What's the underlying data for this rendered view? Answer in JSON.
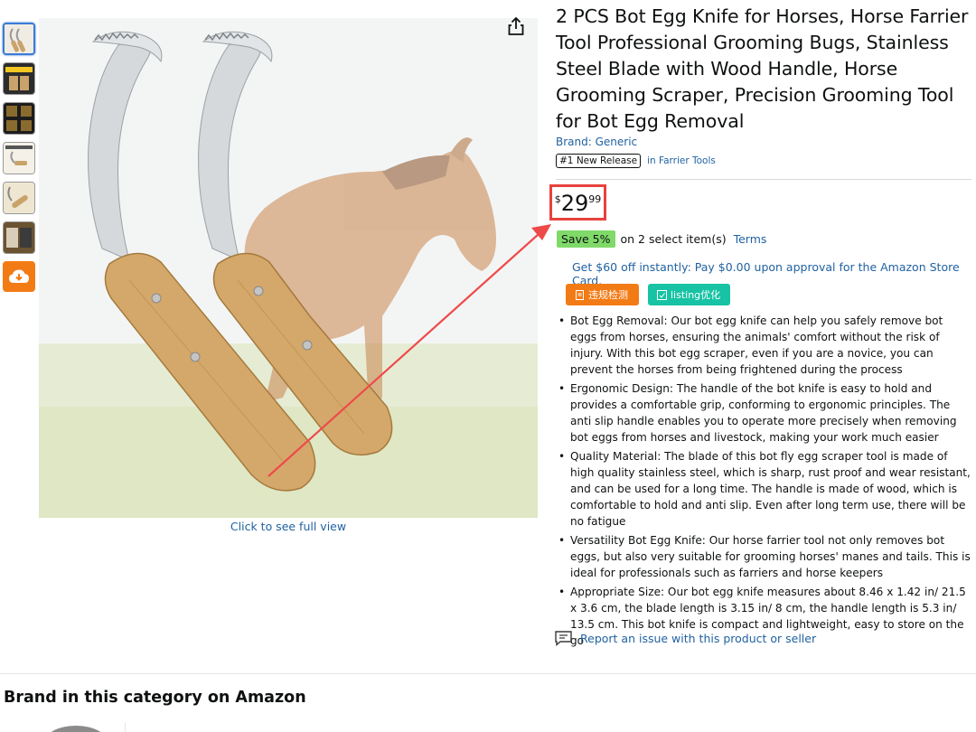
{
  "product": {
    "title": "2 PCS Bot Egg Knife for Horses, Horse Farrier Tool Professional Grooming Bugs, Stainless Steel Blade with Wood Handle, Horse Grooming Scraper, Precision Grooming Tool for Bot Egg Removal",
    "brand_link": "Brand: Generic",
    "rank_badge": "#1 New Release",
    "rank_category": "in Farrier Tools"
  },
  "gallery": {
    "thumbnail_count": 6,
    "full_view_link": "Click to see full view"
  },
  "price": {
    "currency": "$",
    "whole": "29",
    "fraction": "99"
  },
  "savings": {
    "badge": "Save 5%",
    "text": "on 2 select item(s)",
    "terms_link": "Terms"
  },
  "card_offer": "Get $60 off instantly: Pay $0.00 upon approval for the Amazon Store Card.",
  "plugin_buttons": {
    "violation_check": "违规检测",
    "listing_optimize": "listing优化"
  },
  "bullets": [
    "Bot Egg Removal: Our bot egg knife can help you safely remove bot eggs from horses, ensuring the animals' comfort without the risk of injury. With this bot egg scraper, even if you are a novice, you can prevent the horses from being frightened during the process",
    "Ergonomic Design: The handle of the bot knife is easy to hold and provides a comfortable grip, conforming to ergonomic principles. The anti slip handle enables you to operate more precisely when removing bot eggs from horses and livestock, making your work much easier",
    "Quality Material: The blade of this bot fly egg scraper tool is made of high quality stainless steel, which is sharp, rust proof and wear resistant, and can be used for a long time. The handle is made of wood, which is comfortable to hold and anti slip. Even after long term use, there will be no fatigue",
    "Versatility Bot Egg Knife: Our horse farrier tool not only removes bot eggs, but also very suitable for grooming horses' manes and tails. This is ideal for professionals such as farriers and horse keepers",
    "Appropriate Size: Our bot egg knife measures about 8.46 x 1.42 in/ 21.5 x 3.6 cm, the blade length is 3.15 in/ 8 cm, the handle length is 5.3 in/ 13.5 cm. This bot knife is compact and lightweight, easy to store on the go"
  ],
  "report_link": "Report an issue with this product or seller",
  "brand_section": {
    "title": "Brand in this category on Amazon"
  },
  "colors": {
    "link": "#2162a1",
    "price_highlight": "#e8413e",
    "save_badge": "#7fda69",
    "plugin_orange": "#f37b15",
    "plugin_teal": "#17c3a4"
  }
}
